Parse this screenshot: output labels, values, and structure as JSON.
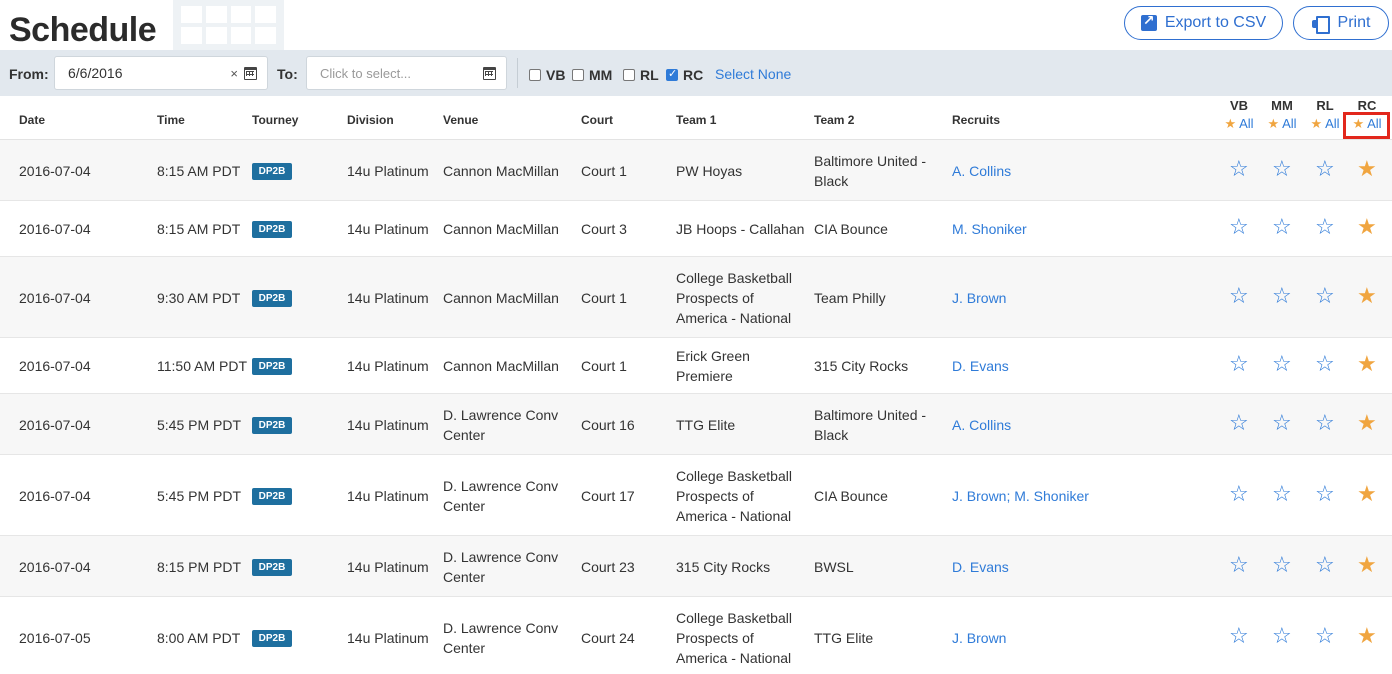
{
  "header": {
    "title": "Schedule",
    "export_label": "Export to CSV",
    "print_label": "Print"
  },
  "filters": {
    "from_label": "From:",
    "from_value": "6/6/2016",
    "clear_glyph": "×",
    "to_label": "To:",
    "to_placeholder": "Click to select...",
    "checkboxes": [
      {
        "label": "VB",
        "checked": false
      },
      {
        "label": "MM",
        "checked": false
      },
      {
        "label": "RL",
        "checked": false
      },
      {
        "label": "RC",
        "checked": true
      }
    ],
    "select_none": "Select None"
  },
  "table": {
    "columns": [
      "Date",
      "Time",
      "Tourney",
      "Division",
      "Venue",
      "Court",
      "Team 1",
      "Team 2",
      "Recruits"
    ],
    "rating_columns": [
      {
        "code": "VB",
        "all": "All"
      },
      {
        "code": "MM",
        "all": "All"
      },
      {
        "code": "RL",
        "all": "All"
      },
      {
        "code": "RC",
        "all": "All"
      }
    ],
    "rows": [
      {
        "date": "2016-07-04",
        "time": "8:15 AM PDT",
        "tourney": "DP2B",
        "division": "14u Platinum",
        "venue": "Cannon MacMillan",
        "court": "Court 1",
        "team1": "PW Hoyas",
        "team2": "Baltimore United - Black",
        "recruits": "A. Collins",
        "stars": [
          false,
          false,
          false,
          true
        ]
      },
      {
        "date": "2016-07-04",
        "time": "8:15 AM PDT",
        "tourney": "DP2B",
        "division": "14u Platinum",
        "venue": "Cannon MacMillan",
        "court": "Court 3",
        "team1": "JB Hoops - Callahan",
        "team2": "CIA Bounce",
        "recruits": "M. Shoniker",
        "stars": [
          false,
          false,
          false,
          true
        ]
      },
      {
        "date": "2016-07-04",
        "time": "9:30 AM PDT",
        "tourney": "DP2B",
        "division": "14u Platinum",
        "venue": "Cannon MacMillan",
        "court": "Court 1",
        "team1": "College Basketball Prospects of America - National",
        "team2": "Team Philly",
        "recruits": "J. Brown",
        "stars": [
          false,
          false,
          false,
          true
        ]
      },
      {
        "date": "2016-07-04",
        "time": "11:50 AM PDT",
        "tourney": "DP2B",
        "division": "14u Platinum",
        "venue": "Cannon MacMillan",
        "court": "Court 1",
        "team1": "Erick Green Premiere",
        "team2": "315 City Rocks",
        "recruits": "D. Evans",
        "stars": [
          false,
          false,
          false,
          true
        ]
      },
      {
        "date": "2016-07-04",
        "time": "5:45 PM PDT",
        "tourney": "DP2B",
        "division": "14u Platinum",
        "venue": "D. Lawrence Conv Center",
        "court": "Court 16",
        "team1": "TTG Elite",
        "team2": "Baltimore United - Black",
        "recruits": "A. Collins",
        "stars": [
          false,
          false,
          false,
          true
        ]
      },
      {
        "date": "2016-07-04",
        "time": "5:45 PM PDT",
        "tourney": "DP2B",
        "division": "14u Platinum",
        "venue": "D. Lawrence Conv Center",
        "court": "Court 17",
        "team1": "College Basketball Prospects of America - National",
        "team2": "CIA Bounce",
        "recruits": "J. Brown;  M. Shoniker",
        "stars": [
          false,
          false,
          false,
          true
        ]
      },
      {
        "date": "2016-07-04",
        "time": "8:15 PM PDT",
        "tourney": "DP2B",
        "division": "14u Platinum",
        "venue": "D. Lawrence Conv Center",
        "court": "Court 23",
        "team1": "315 City Rocks",
        "team2": "BWSL",
        "recruits": "D. Evans",
        "stars": [
          false,
          false,
          false,
          true
        ]
      },
      {
        "date": "2016-07-05",
        "time": "8:00 AM PDT",
        "tourney": "DP2B",
        "division": "14u Platinum",
        "venue": "D. Lawrence Conv Center",
        "court": "Court 24",
        "team1": "College Basketball Prospects of America - National",
        "team2": "TTG Elite",
        "recruits": "J. Brown",
        "stars": [
          false,
          false,
          false,
          true
        ]
      }
    ]
  },
  "colors": {
    "accent": "#2f7bd8",
    "star_on": "#f0a540",
    "badge": "#1e6f9f",
    "highlight": "#e2271c"
  },
  "icons": {
    "star_empty": "☆",
    "star_full": "★",
    "export": "external-link-icon",
    "print": "printer-icon",
    "calendar": "calendar-icon"
  }
}
